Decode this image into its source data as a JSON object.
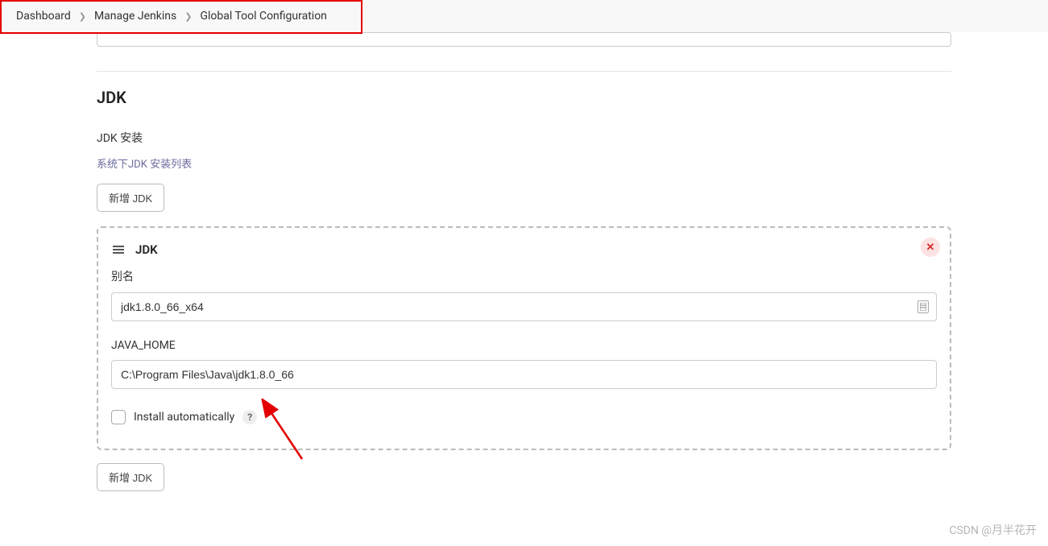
{
  "breadcrumb": {
    "items": [
      "Dashboard",
      "Manage Jenkins",
      "Global Tool Configuration"
    ]
  },
  "section": {
    "title": "JDK",
    "install_label": "JDK 安装",
    "list_desc": "系统下JDK 安装列表",
    "add_button": "新增 JDK",
    "add_button_bottom": "新增 JDK"
  },
  "jdk_config": {
    "header": "JDK",
    "alias_label": "别名",
    "alias_value": "jdk1.8.0_66_x64",
    "java_home_label": "JAVA_HOME",
    "java_home_value": "C:\\Program Files\\Java\\jdk1.8.0_66",
    "install_auto_label": "Install automatically",
    "help_symbol": "?",
    "close_symbol": "✕"
  },
  "watermark": "CSDN @月半花开"
}
